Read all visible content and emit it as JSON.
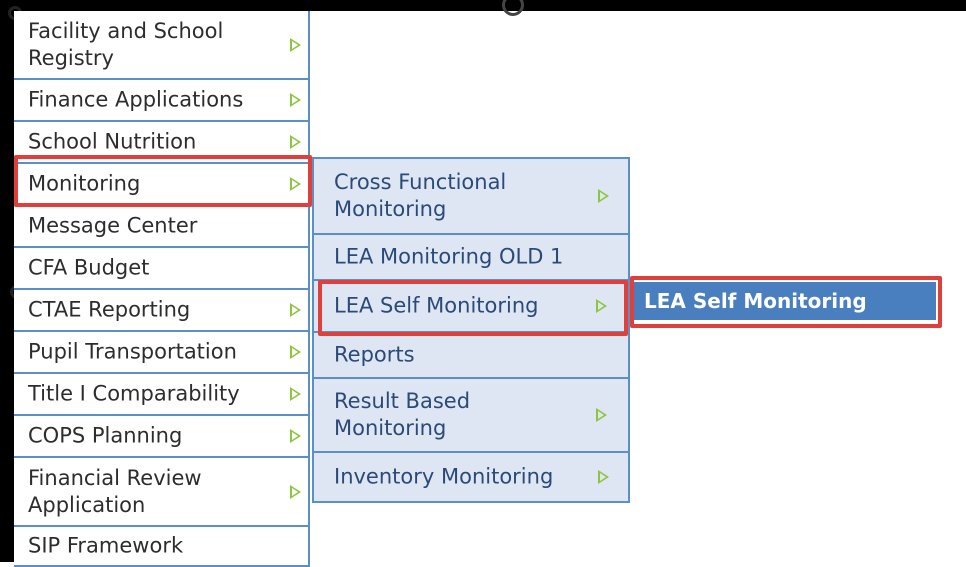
{
  "main_menu": {
    "items": [
      {
        "label": "Facility and School\nRegistry",
        "has_submenu": true
      },
      {
        "label": "Finance Applications",
        "has_submenu": true
      },
      {
        "label": "School Nutrition",
        "has_submenu": true
      },
      {
        "label": "Monitoring",
        "has_submenu": true
      },
      {
        "label": "Message Center",
        "has_submenu": false
      },
      {
        "label": "CFA Budget",
        "has_submenu": false
      },
      {
        "label": "CTAE Reporting",
        "has_submenu": true
      },
      {
        "label": "Pupil Transportation",
        "has_submenu": true
      },
      {
        "label": "Title I Comparability",
        "has_submenu": true
      },
      {
        "label": "COPS Planning",
        "has_submenu": true
      },
      {
        "label": "Financial Review\nApplication",
        "has_submenu": true
      },
      {
        "label": "SIP Framework",
        "has_submenu": false
      }
    ]
  },
  "sub_menu": {
    "items": [
      {
        "label": "Cross Functional\nMonitoring",
        "has_submenu": true
      },
      {
        "label": "LEA Monitoring OLD 1",
        "has_submenu": false
      },
      {
        "label": "LEA Self Monitoring",
        "has_submenu": true
      },
      {
        "label": "Reports",
        "has_submenu": false
      },
      {
        "label": "Result Based\nMonitoring",
        "has_submenu": true
      },
      {
        "label": "Inventory Monitoring",
        "has_submenu": true
      }
    ]
  },
  "third_menu": {
    "items": [
      {
        "label": "LEA Self Monitoring"
      }
    ]
  },
  "colors": {
    "highlight": "#e0403b",
    "submenu_bg": "#dde6f2",
    "selected_bg": "#4a7fbf",
    "arrow": "#8cc63f",
    "border": "#5b8fc7"
  },
  "icons": {
    "submenu_indicator": "green-triangle-arrow-icon"
  }
}
